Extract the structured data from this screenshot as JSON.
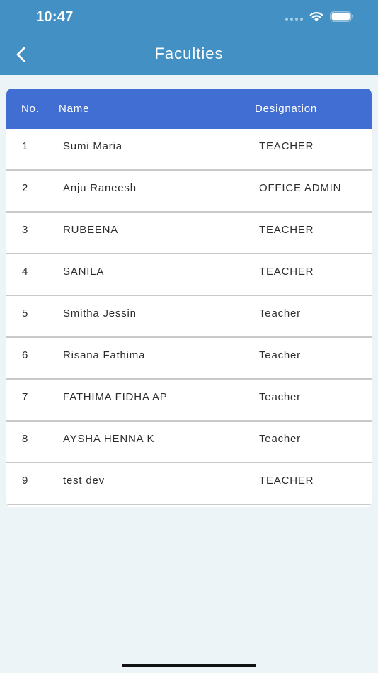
{
  "status_bar": {
    "time": "10:47",
    "icons": [
      "signal-dots-icon",
      "wifi-icon",
      "battery-icon"
    ]
  },
  "header": {
    "title": "Faculties",
    "back_icon": "chevron-left-icon",
    "background": "#4390c4"
  },
  "table": {
    "header_color": "#416ed2",
    "columns": {
      "no": "No.",
      "name": "Name",
      "designation": "Designation"
    },
    "rows": [
      {
        "no": "1",
        "name": "Sumi Maria",
        "designation": "TEACHER"
      },
      {
        "no": "2",
        "name": "Anju Raneesh",
        "designation": "OFFICE ADMIN"
      },
      {
        "no": "3",
        "name": "RUBEENA",
        "designation": "TEACHER"
      },
      {
        "no": "4",
        "name": "SANILA",
        "designation": "TEACHER"
      },
      {
        "no": "5",
        "name": "Smitha Jessin",
        "designation": "Teacher"
      },
      {
        "no": "6",
        "name": "Risana Fathima",
        "designation": "Teacher"
      },
      {
        "no": "7",
        "name": "FATHIMA FIDHA AP",
        "designation": "Teacher"
      },
      {
        "no": "8",
        "name": "AYSHA HENNA K",
        "designation": "Teacher"
      },
      {
        "no": "9",
        "name": "test dev",
        "designation": "TEACHER"
      }
    ]
  }
}
